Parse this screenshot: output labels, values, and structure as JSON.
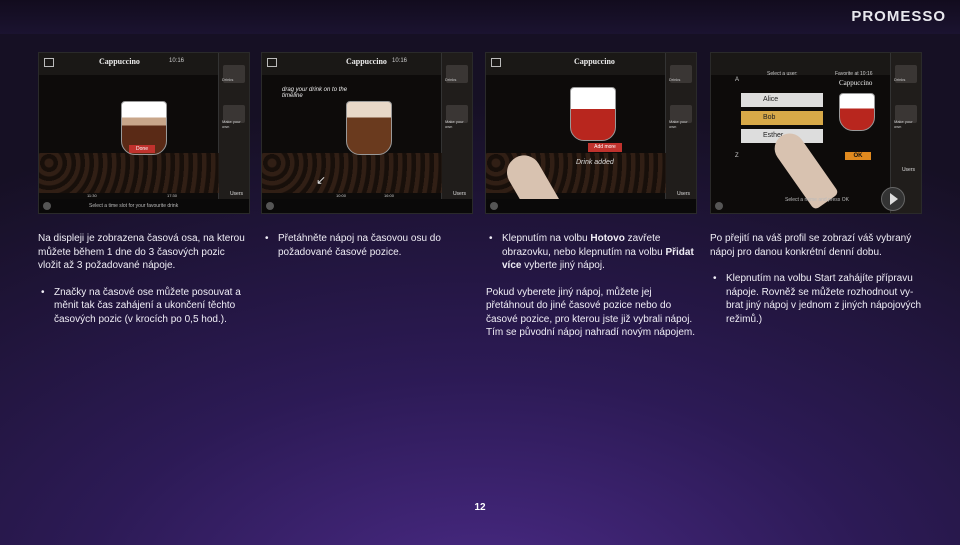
{
  "brand": "PROMESSO",
  "page_number": "12",
  "screens": {
    "s1": {
      "title": "Cappuccino",
      "time": "10:16",
      "drinks": "Drinks",
      "make": "Make your own",
      "done": "Done",
      "t1": "11:30",
      "t2": "17:30",
      "hint": "Select a time slot for your favourite drink",
      "users": "Users"
    },
    "s2": {
      "title": "Cappuccino",
      "time": "10:16",
      "drinks": "Drinks",
      "make": "Make your own",
      "drag": "drag your drink on to the timeline",
      "t1": "10:00",
      "t2": "16:00",
      "users": "Users"
    },
    "s3": {
      "title": "Cappuccino",
      "drinks": "Drinks",
      "make": "Make your own",
      "add_more": "Add more",
      "added": "Drink added",
      "users": "Users"
    },
    "s4": {
      "select": "Select a user:",
      "favorite": "Favorite at 10:16",
      "fav_drink": "Cappuccino",
      "drinks": "Drinks",
      "make": "Make your own",
      "users_list": [
        "Alice",
        "Bob",
        "Esther"
      ],
      "ok": "OK",
      "hint": "Select a name and press OK",
      "letter_a": "A",
      "letter_z": "Z",
      "users": "Users"
    }
  },
  "col1": {
    "p1": "Na displeji je zobrazena časová osa, na kterou můžete během 1 dne do 3 časových pozic vložit až 3 požadované nápoje.",
    "b1": "Značky na časové ose můžete posouvat a měnit tak čas zahájení a ukončení těchto časových pozic (v krocích po 0,5 hod.)."
  },
  "col2": {
    "b1": "Přetáhněte nápoj na časovou osu do požadované časové pozice."
  },
  "col3": {
    "b1_pre": "Klepnutím na volbu ",
    "b1_bold1": "Hotovo",
    "b1_mid": " zavřete obrazovku, nebo klepnutím na volbu ",
    "b1_bold2": "Přidat více",
    "b1_post": " vyberte jiný nápoj.",
    "p1": "Pokud vyberete jiný nápoj, můžete jej přetáhnout do jiné časové pozice nebo do časové pozice, pro kterou jste již vybrali nápoj. Tím se původní nápoj nahradí novým nápojem."
  },
  "col4": {
    "p1": "Po přejití na váš profil se zobrazí váš vybraný nápoj pro danou konkrétní denní dobu.",
    "b1": "Klepnutím na volbu Start zahájíte přípravu nápoje. Rovněž se můžete rozhodnout vy-brat jiný nápoj v jednom z jiných nápojových režimů.)"
  }
}
